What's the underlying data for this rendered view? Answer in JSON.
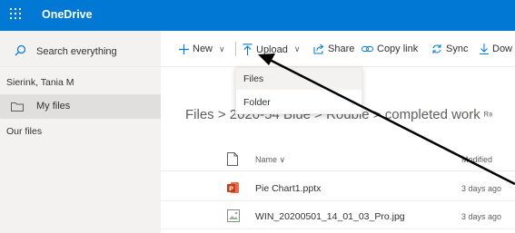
{
  "header": {
    "app_title": "OneDrive",
    "brand_color": "#0078d4",
    "waffle_icon": "app-launcher-icon"
  },
  "search": {
    "label": "Search everything",
    "icon": "search-icon"
  },
  "sidebar": {
    "user_name": "Sierink, Tania M",
    "items": [
      {
        "label": "My files",
        "icon": "folder-icon",
        "selected": true
      },
      {
        "label": "Our files",
        "selected": false
      }
    ]
  },
  "command_bar": {
    "new_label": "New",
    "upload_label": "Upload",
    "share_label": "Share",
    "copy_link_label": "Copy link",
    "sync_label": "Sync",
    "download_label": "Dow"
  },
  "upload_menu": {
    "items": [
      "Files",
      "Folder"
    ]
  },
  "breadcrumb": {
    "text": "Files > 2020-54 Blue > Rouble > completed work",
    "share_icon": "people-icon"
  },
  "file_list": {
    "columns": {
      "name": "Name",
      "modified": "Modified"
    },
    "rows": [
      {
        "name": "Pie Chart1.pptx",
        "modified": "3 days ago",
        "icon": "powerpoint-icon"
      },
      {
        "name": "WIN_20200501_14_01_03_Pro.jpg",
        "modified": "3 days ago",
        "icon": "image-file-icon"
      }
    ]
  },
  "annotation": {
    "icon": "arrow-annotation"
  }
}
